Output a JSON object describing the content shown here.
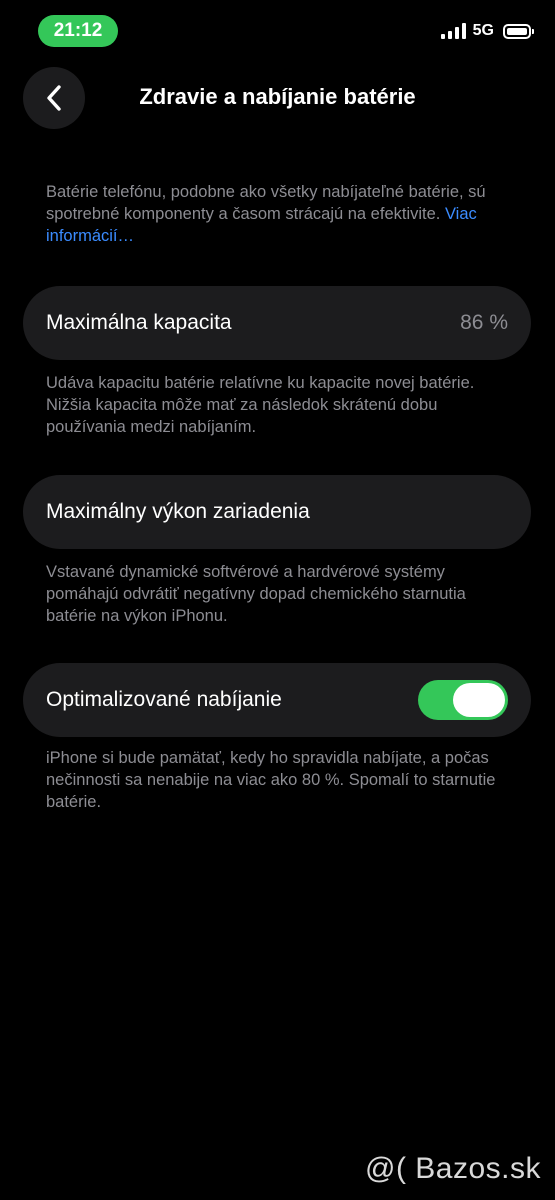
{
  "status_bar": {
    "time": "21:12",
    "network": "5G",
    "time_pill_color": "#34c759"
  },
  "nav": {
    "back_icon": "chevron-left-icon",
    "title": "Zdravie a nabíjanie batérie"
  },
  "intro": {
    "text": "Batérie telefónu, podobne ako všetky nabíjateľné batérie, sú spotrebné komponenty a časom strácajú na efektivite. ",
    "link": "Viac informácií…"
  },
  "max_capacity": {
    "label": "Maximálna kapacita",
    "value": "86 %",
    "description": "Udáva kapacitu batérie relatívne ku kapacite novej batérie. Nižšia kapacita môže mať za následok skrátenú dobu používania medzi nabíjaním."
  },
  "peak_performance": {
    "label": "Maximálny výkon zariadenia",
    "description": "Vstavané dynamické softvérové a hardvérové systémy pomáhajú odvrátiť negatívny dopad chemického starnutia batérie na výkon iPhonu."
  },
  "optimized_charging": {
    "label": "Optimalizované nabíjanie",
    "enabled": true,
    "toggle_color": "#34c759",
    "description": "iPhone si bude pamätať, kedy ho spravidla nabíjate, a počas nečinnosti sa nenabije na viac ako 80 %. Spomalí to starnutie batérie."
  },
  "watermark": "@( Bazos.sk"
}
